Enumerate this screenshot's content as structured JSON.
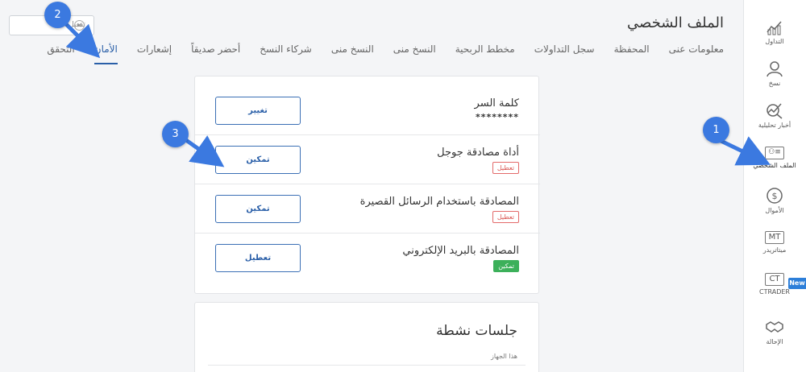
{
  "page": {
    "title": "الملف الشخصي"
  },
  "top_box": {
    "text": "تفعيل",
    "icon": "x-circle-icon"
  },
  "tabs": [
    "معلومات عنى",
    "المحفظة",
    "سجل التداولات",
    "مخطط الربحية",
    "النسخ منى",
    "النسخ منى",
    "شركاء النسخ",
    "أحضر صديقاً",
    "إشعارات",
    "الأمان",
    "التحقق"
  ],
  "active_tab": "الأمان",
  "sidebar": [
    {
      "label": "التداول",
      "icon": "chart-icon"
    },
    {
      "label": "نسخ",
      "icon": "user-copy-icon"
    },
    {
      "label": "أخبار تحليلية",
      "icon": "analysis-icon"
    },
    {
      "label": "الملف الشخصي",
      "icon": "profile-card-icon"
    },
    {
      "label": "الأموال",
      "icon": "dollar-icon"
    },
    {
      "label": "ميتاتريدر",
      "icon": "MT"
    },
    {
      "label": "CTRADER",
      "icon": "CT"
    },
    {
      "label": "الإحالة",
      "icon": "handshake-icon"
    }
  ],
  "new_badge": "New",
  "security": {
    "password": {
      "label": "كلمة السر",
      "value": "********",
      "button": "تغيير"
    },
    "google_auth": {
      "label": "أداة مصادقة جوجل",
      "status": "تعطيل",
      "button": "تمكين"
    },
    "sms_auth": {
      "label": "المصادقة باستخدام الرسائل القصيرة",
      "status": "تعطيل",
      "button": "تمكين"
    },
    "email_auth": {
      "label": "المصادقة بالبريد الإلكتروني",
      "status": "تمكين",
      "button": "تعطيل"
    }
  },
  "sessions": {
    "title": "جلسات نشطة",
    "device": "هذا الجهاز"
  },
  "callouts": [
    "1",
    "2",
    "3"
  ],
  "colors": {
    "accent": "#2a5fa8",
    "callout": "#3b79e0",
    "enabled": "#3cb05a",
    "disabled": "#d9534f"
  }
}
